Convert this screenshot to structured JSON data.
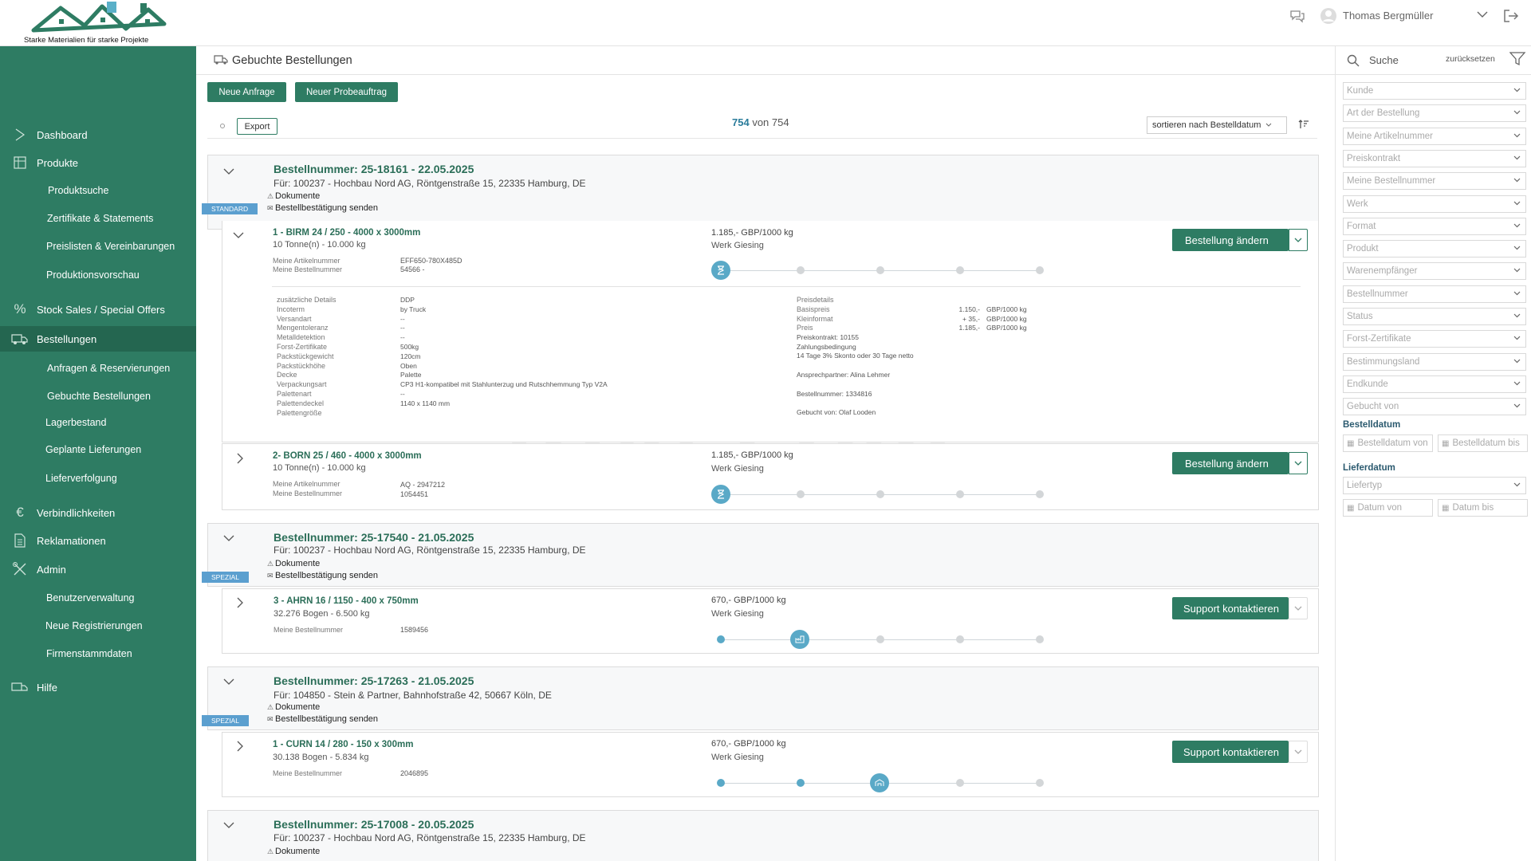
{
  "brand": {
    "tagline": "Starke Materialien für starke Projekte",
    "color": "#2e7c63"
  },
  "user": {
    "name": "Thomas Bergmüller"
  },
  "sidebar": {
    "items": [
      {
        "label": "Dashboard",
        "icon": "dashboard-icon"
      },
      {
        "label": "Produkte",
        "icon": "products-icon"
      },
      {
        "label": "Produktsuche"
      },
      {
        "label": "Zertifikate & Statements"
      },
      {
        "label": "Preislisten & Vereinbarungen"
      },
      {
        "label": "Produktionsvorschau"
      },
      {
        "label": "Stock Sales / Special Offers",
        "icon": "percent-icon"
      },
      {
        "label": "Bestellungen",
        "icon": "truck-icon"
      },
      {
        "label": "Anfragen & Reservierungen"
      },
      {
        "label": "Gebuchte Bestellungen"
      },
      {
        "label": "Lagerbestand"
      },
      {
        "label": "Geplante Lieferungen"
      },
      {
        "label": "Lieferverfolgung"
      },
      {
        "label": "Verbindlichkeiten",
        "icon": "euro-icon"
      },
      {
        "label": "Reklamationen",
        "icon": "document-icon"
      },
      {
        "label": "Admin",
        "icon": "tools-icon"
      },
      {
        "label": "Benutzerverwaltung"
      },
      {
        "label": "Neue Registrierungen"
      },
      {
        "label": "Firmenstammdaten"
      },
      {
        "label": "Hilfe",
        "icon": "help-icon"
      }
    ]
  },
  "page": {
    "title": "Gebuchte Bestellungen"
  },
  "buttons": {
    "new_request": "Neue Anfrage",
    "new_trial": "Neuer Probeauftrag",
    "export": "Export"
  },
  "counter": {
    "shown": "754",
    "sep": "von",
    "total": "754"
  },
  "sort": {
    "value": "sortieren nach Bestelldatum"
  },
  "search": {
    "label": "Suche",
    "reset": "zurücksetzen"
  },
  "filters": {
    "selects": [
      "Kunde",
      "Art der Bestellung",
      "Meine Artikelnummer",
      "Preiskontrakt",
      "Meine Bestellnummer",
      "Werk",
      "Format",
      "Produkt",
      "Warenempfänger",
      "Bestellnummer",
      "Status",
      "Forst-Zertifikate",
      "Bestimmungsland",
      "Endkunde",
      "Gebucht von"
    ],
    "bestelldatum": {
      "label": "Bestelldatum",
      "from": "Bestelldatum von",
      "to": "Bestelldatum bis"
    },
    "lieferdatum": {
      "label": "Lieferdatum",
      "type": "Liefertyp",
      "from": "Datum von",
      "to": "Datum bis"
    }
  },
  "common": {
    "docs": "Dokumente",
    "confirm": "Bestellbestätigung senden",
    "art_nr_label": "Meine Artikelnummer",
    "best_nr_label": "Meine Bestellnummer",
    "werk": "Werk Giesing",
    "change_order": "Bestellung ändern",
    "contact_support": "Support kontaktieren"
  },
  "orders": [
    {
      "title": "Bestellnummer: 25-18161 - 22.05.2025",
      "for": "Für: 100237 - Hochbau Nord AG, Röntgenstraße 15, 22335 Hamburg, DE",
      "badge": "STANDARD",
      "positions": [
        {
          "title": "1 - BIRM 24 /  250 - 4000 x 3000mm",
          "qty": "10 Tonne(n) - 10.000 kg",
          "art_nr": "EFF650-780X485D",
          "best_nr": "54566 -",
          "price": "1.185,- GBP/1000 kg",
          "progress_step": 1
        },
        {
          "title": "2- BORN 25 /  460 - 4000 x 3000mm",
          "qty": "10 Tonne(n) - 10.000 kg",
          "art_nr": "AQ - 2947212",
          "best_nr": "1054451",
          "price": "1.185,- GBP/1000 kg",
          "progress_step": 1
        }
      ],
      "details": {
        "labels": "zusätzliche Details\nIncoterm\nVersandart\nMengentoleranz\nMetalldetektion\nForst-Zertifikate\nPackstückgewicht\nPackstückhöhe\nDecke\nVerpackungsart\nPalettenart\nPalettendeckel\nPalettengröße",
        "values": "DDP\nby Truck\n--\n--\n--\n500kg\n120cm\nOben\nPalette\nCP3 H1-kompatibel mit Stahlunterzug und Rutschhemmung Typ V2A\n--\n1140 x 1140 mm\n",
        "price_labels": "Preisdetails\nBasispreis\nKleinformat\nPreis",
        "price_nums": "\n1.150,-\n+ 35,-\n1.185,-",
        "price_units": "\nGBP/1000 kg\nGBP/1000 kg\nGBP/1000 kg",
        "contract": "Preiskontrakt: 10155",
        "payment_label": "Zahlungsbedingung",
        "payment": "14 Tage 3% Skonto oder 30 Tage netto",
        "contact": "Ansprechpartner: Alina Lehmer",
        "order_nr": "Bestellnummer: 1334816",
        "booked_by": "Gebucht von: Olaf Looden"
      }
    },
    {
      "title": "Bestellnummer: 25-17540 - 21.05.2025",
      "for": "Für: 100237 - Hochbau Nord AG, Röntgenstraße 15, 22335 Hamburg, DE",
      "badge": "SPEZIAL",
      "positions": [
        {
          "title": "3 - AHRN 16 /  1150 - 400 x 750mm",
          "qty": "32.276 Bogen - 6.500 kg",
          "best_nr": "1589456",
          "price": "670,- GBP/1000 kg",
          "progress_step": 2
        }
      ]
    },
    {
      "title": "Bestellnummer: 25-17263 - 21.05.2025",
      "for": "Für: 104850 - Stein & Partner, Bahnhofstraße 42, 50667 Köln, DE",
      "badge": "SPEZIAL",
      "positions": [
        {
          "title": "1 - CURN 14 /  280 - 150 x 300mm",
          "qty": "30.138 Bogen - 5.834 kg",
          "best_nr": "2046895",
          "price": "670,- GBP/1000 kg",
          "progress_step": 3
        }
      ]
    },
    {
      "title": "Bestellnummer: 25-17008 - 20.05.2025",
      "for": "Für: 100237 - Hochbau Nord AG, Röntgenstraße 15, 22335 Hamburg, DE"
    }
  ]
}
